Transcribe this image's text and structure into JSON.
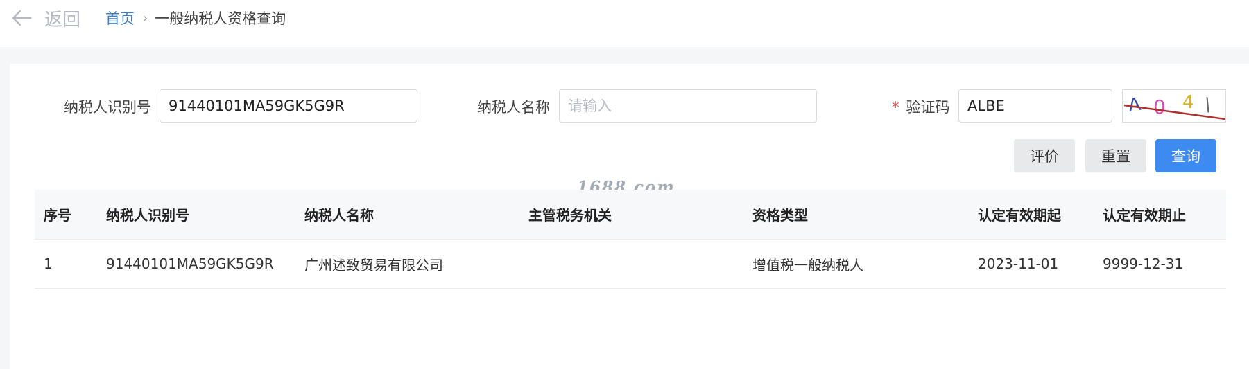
{
  "header": {
    "back_label": "返回",
    "breadcrumb": {
      "home": "首页",
      "separator": "›",
      "current": "一般纳税人资格查询"
    }
  },
  "form": {
    "taxpayer_id": {
      "label": "纳税人识别号",
      "value": "91440101MA59GK5G9R"
    },
    "taxpayer_name": {
      "label": "纳税人名称",
      "value": "",
      "placeholder": "请输入"
    },
    "captcha": {
      "required_mark": "*",
      "label": "验证码",
      "value": "ALBE",
      "image_text": "A04\\"
    }
  },
  "buttons": {
    "evaluate": "评价",
    "reset": "重置",
    "query": "查询"
  },
  "watermark": "1688.com",
  "table": {
    "columns": [
      "序号",
      "纳税人识别号",
      "纳税人名称",
      "主管税务机关",
      "资格类型",
      "认定有效期起",
      "认定有效期止"
    ],
    "rows": [
      [
        "1",
        "91440101MA59GK5G9R",
        "广州述致贸易有限公司",
        "",
        "增值税一般纳税人",
        "2023-11-01",
        "9999-12-31"
      ]
    ]
  },
  "colors": {
    "link": "#3e7ec9",
    "primary": "#3d8af0",
    "required": "#e64545"
  }
}
